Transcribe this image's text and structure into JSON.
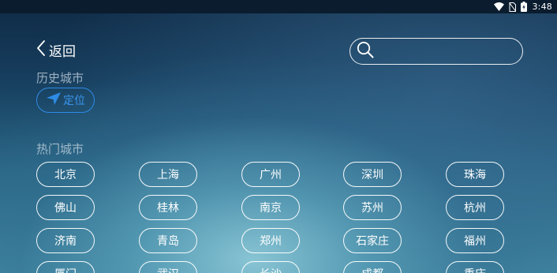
{
  "status_bar": {
    "time": "3:48",
    "icons": [
      "wifi-icon",
      "no-sim-icon",
      "battery-charging-icon"
    ]
  },
  "header": {
    "back_label": "返回",
    "back_icon": "chevron-left-icon"
  },
  "search": {
    "icon": "search-icon",
    "value": "",
    "placeholder": ""
  },
  "history": {
    "title": "历史城市",
    "locate_label": "定位",
    "locate_icon": "navigation-arrow-icon",
    "accent_color": "#2e8be6"
  },
  "hot": {
    "title": "热门城市",
    "rows": [
      [
        "北京",
        "上海",
        "广州",
        "深圳",
        "珠海"
      ],
      [
        "佛山",
        "桂林",
        "南京",
        "苏州",
        "杭州"
      ],
      [
        "济南",
        "青岛",
        "郑州",
        "石家庄",
        "福州"
      ],
      [
        "厦门",
        "武汉",
        "长沙",
        "成都",
        "重庆"
      ]
    ]
  }
}
